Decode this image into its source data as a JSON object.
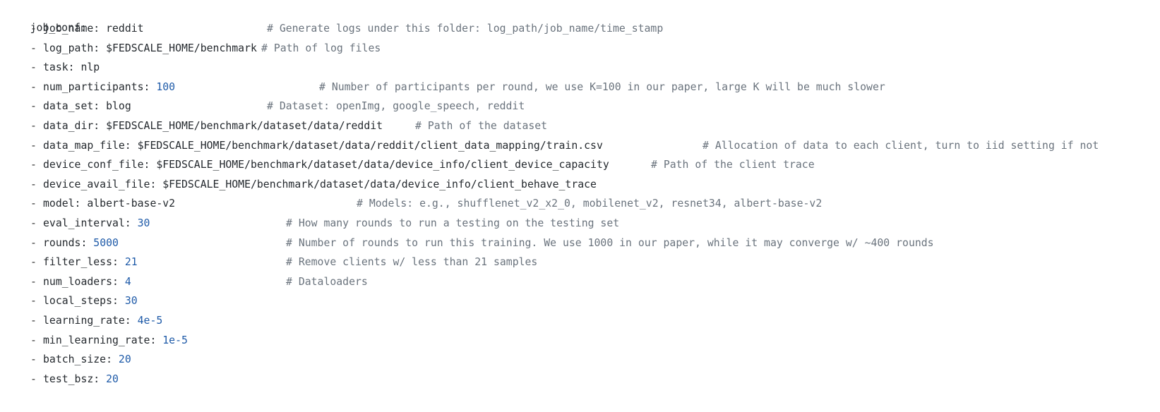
{
  "colors": {
    "text": "#24292e",
    "number": "#1e5aa8",
    "comment": "#6a737d",
    "background": "#ffffff"
  },
  "root_key": "job_conf:",
  "lines": [
    {
      "dash": "- ",
      "key": "job_name: ",
      "value": "reddit",
      "value_kind": "string",
      "comment": "# Generate logs under this folder: log_path/job_name/time_stamp"
    },
    {
      "dash": "- ",
      "key": "log_path: ",
      "value": "$FEDSCALE_HOME/benchmark",
      "value_kind": "string",
      "comment": "# Path of log files"
    },
    {
      "dash": "- ",
      "key": "task: ",
      "value": "nlp",
      "value_kind": "string",
      "comment": ""
    },
    {
      "dash": "- ",
      "key": "num_participants: ",
      "value": "100",
      "value_kind": "number",
      "comment": "# Number of participants per round, we use K=100 in our paper, large K will be much slower"
    },
    {
      "dash": "- ",
      "key": "data_set: ",
      "value": "blog",
      "value_kind": "string",
      "comment": "# Dataset: openImg, google_speech, reddit"
    },
    {
      "dash": "- ",
      "key": "data_dir: ",
      "value": "$FEDSCALE_HOME/benchmark/dataset/data/reddit",
      "value_kind": "string",
      "comment": "# Path of the dataset"
    },
    {
      "dash": "- ",
      "key": "data_map_file: ",
      "value": "$FEDSCALE_HOME/benchmark/dataset/data/reddit/client_data_mapping/train.csv",
      "value_kind": "string",
      "comment": "# Allocation of data to each client, turn to iid setting if not"
    },
    {
      "dash": "- ",
      "key": "device_conf_file: ",
      "value": "$FEDSCALE_HOME/benchmark/dataset/data/device_info/client_device_capacity",
      "value_kind": "string",
      "comment": "# Path of the client trace"
    },
    {
      "dash": "- ",
      "key": "device_avail_file: ",
      "value": "$FEDSCALE_HOME/benchmark/dataset/data/device_info/client_behave_trace",
      "value_kind": "string",
      "comment": ""
    },
    {
      "dash": "- ",
      "key": "model: ",
      "value": "albert-base-v2",
      "value_kind": "string",
      "comment": "# Models: e.g., shufflenet_v2_x2_0, mobilenet_v2, resnet34, albert-base-v2"
    },
    {
      "dash": "- ",
      "key": "eval_interval: ",
      "value": "30",
      "value_kind": "number",
      "comment": "# How many rounds to run a testing on the testing set"
    },
    {
      "dash": "- ",
      "key": "rounds: ",
      "value": "5000",
      "value_kind": "number",
      "comment": "# Number of rounds to run this training. We use 1000 in our paper, while it may converge w/ ~400 rounds"
    },
    {
      "dash": "- ",
      "key": "filter_less: ",
      "value": "21",
      "value_kind": "number",
      "comment": "# Remove clients w/ less than 21 samples"
    },
    {
      "dash": "- ",
      "key": "num_loaders: ",
      "value": "4",
      "value_kind": "number",
      "comment": "# Dataloaders"
    },
    {
      "dash": "- ",
      "key": "local_steps: ",
      "value": "30",
      "value_kind": "number",
      "comment": ""
    },
    {
      "dash": "- ",
      "key": "learning_rate: ",
      "value": "4e-5",
      "value_kind": "number",
      "comment": ""
    },
    {
      "dash": "- ",
      "key": "min_learning_rate: ",
      "value": "1e-5",
      "value_kind": "number",
      "comment": ""
    },
    {
      "dash": "- ",
      "key": "batch_size: ",
      "value": "20",
      "value_kind": "number",
      "comment": ""
    },
    {
      "dash": "- ",
      "key": "test_bsz: ",
      "value": "20",
      "value_kind": "number",
      "comment": ""
    }
  ]
}
